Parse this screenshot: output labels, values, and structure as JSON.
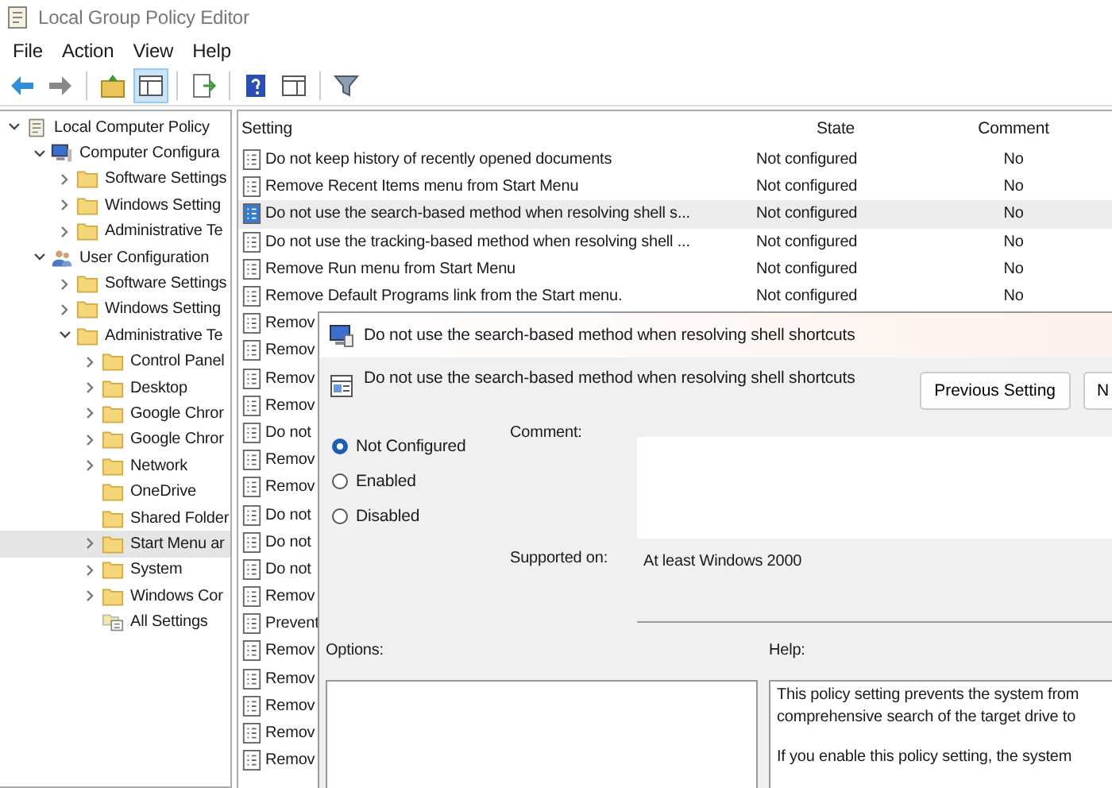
{
  "window": {
    "title": "Local Group Policy Editor"
  },
  "menu": [
    "File",
    "Action",
    "View",
    "Help"
  ],
  "toolbar": [
    {
      "kind": "back",
      "selected": false
    },
    {
      "kind": "forward",
      "selected": false
    },
    {
      "kind": "sep"
    },
    {
      "kind": "up",
      "selected": false
    },
    {
      "kind": "tree",
      "selected": true
    },
    {
      "kind": "sep"
    },
    {
      "kind": "export",
      "selected": false
    },
    {
      "kind": "sep"
    },
    {
      "kind": "help",
      "selected": false
    },
    {
      "kind": "pane",
      "selected": false
    },
    {
      "kind": "sep"
    },
    {
      "kind": "filter",
      "selected": false
    }
  ],
  "tree": [
    {
      "label": "Local Computer Policy",
      "kind": "policy",
      "selected": false,
      "expanded": true,
      "children": [
        {
          "label": "Computer Configura",
          "kind": "computer",
          "selected": false,
          "expanded": true,
          "children": [
            {
              "label": "Software Settings",
              "kind": "folder",
              "selected": false,
              "expanded": false
            },
            {
              "label": "Windows Setting",
              "kind": "folder",
              "selected": false,
              "expanded": false
            },
            {
              "label": "Administrative Te",
              "kind": "folder",
              "selected": false,
              "expanded": false
            }
          ]
        },
        {
          "label": "User Configuration",
          "kind": "user",
          "selected": false,
          "expanded": true,
          "children": [
            {
              "label": "Software Settings",
              "kind": "folder",
              "selected": false,
              "expanded": false
            },
            {
              "label": "Windows Setting",
              "kind": "folder",
              "selected": false,
              "expanded": false
            },
            {
              "label": "Administrative Te",
              "kind": "folder",
              "selected": false,
              "expanded": true,
              "children": [
                {
                  "label": "Control Panel",
                  "kind": "folder",
                  "selected": false,
                  "expanded": false
                },
                {
                  "label": "Desktop",
                  "kind": "folder",
                  "selected": false,
                  "expanded": false
                },
                {
                  "label": "Google Chror",
                  "kind": "folder",
                  "selected": false,
                  "expanded": false
                },
                {
                  "label": "Google Chror",
                  "kind": "folder",
                  "selected": false,
                  "expanded": false
                },
                {
                  "label": "Network",
                  "kind": "folder",
                  "selected": false,
                  "expanded": false
                },
                {
                  "label": "OneDrive",
                  "kind": "folder",
                  "selected": false
                },
                {
                  "label": "Shared Folder",
                  "kind": "folder",
                  "selected": false
                },
                {
                  "label": "Start Menu ar",
                  "kind": "folder",
                  "selected": true,
                  "expanded": false
                },
                {
                  "label": "System",
                  "kind": "folder",
                  "selected": false,
                  "expanded": false
                },
                {
                  "label": "Windows Cor",
                  "kind": "folder",
                  "selected": false,
                  "expanded": false
                },
                {
                  "label": "All Settings",
                  "kind": "settings",
                  "selected": false
                }
              ]
            }
          ]
        }
      ]
    }
  ],
  "table": {
    "columns": [
      "Setting",
      "State",
      "Comment"
    ],
    "rows": [
      {
        "setting": "Do not keep history of recently opened documents",
        "state": "Not configured",
        "comment": "No",
        "selected": false
      },
      {
        "setting": "Remove Recent Items menu from Start Menu",
        "state": "Not configured",
        "comment": "No",
        "selected": false
      },
      {
        "setting": "Do not use the search-based method when resolving shell s...",
        "state": "Not configured",
        "comment": "No",
        "selected": true
      },
      {
        "setting": "Do not use the tracking-based method when resolving shell ...",
        "state": "Not configured",
        "comment": "No",
        "selected": false
      },
      {
        "setting": "Remove Run menu from Start Menu",
        "state": "Not configured",
        "comment": "No",
        "selected": false
      },
      {
        "setting": "Remove Default Programs link from the Start menu.",
        "state": "Not configured",
        "comment": "No",
        "selected": false
      },
      {
        "setting": "Remov",
        "selected": false
      },
      {
        "setting": "Remov",
        "selected": false
      },
      {
        "setting": "Remov",
        "selected": false
      },
      {
        "setting": "Remov",
        "selected": false
      },
      {
        "setting": "Do not",
        "selected": false
      },
      {
        "setting": "Remov",
        "selected": false
      },
      {
        "setting": "Remov",
        "selected": false
      },
      {
        "setting": "Do not",
        "selected": false
      },
      {
        "setting": "Do not",
        "selected": false
      },
      {
        "setting": "Do not",
        "selected": false
      },
      {
        "setting": "Remov",
        "selected": false
      },
      {
        "setting": "Prevent",
        "selected": false
      },
      {
        "setting": "Remov",
        "selected": false
      },
      {
        "setting": "Remov",
        "selected": false
      },
      {
        "setting": "Remov",
        "selected": false
      },
      {
        "setting": "Remov",
        "selected": false
      },
      {
        "setting": "Remov",
        "selected": false
      }
    ]
  },
  "dialog": {
    "title": "Do not use the search-based method when resolving shell shortcuts",
    "heading": "Do not use the search-based method when resolving shell shortcuts",
    "buttons": [
      "Previous Setting",
      "N"
    ],
    "options": [
      {
        "label": "Not Configured",
        "selected": true
      },
      {
        "label": "Enabled",
        "selected": false
      },
      {
        "label": "Disabled",
        "selected": false
      }
    ],
    "comment_label": "Comment:",
    "supported_label": "Supported on:",
    "supported_value": "At least Windows 2000",
    "options_label": "Options:",
    "help_label": "Help:",
    "help": [
      [
        "This policy setting prevents the system from",
        "comprehensive search of the target drive to"
      ],
      [
        "If you enable this policy setting, the system"
      ]
    ]
  }
}
